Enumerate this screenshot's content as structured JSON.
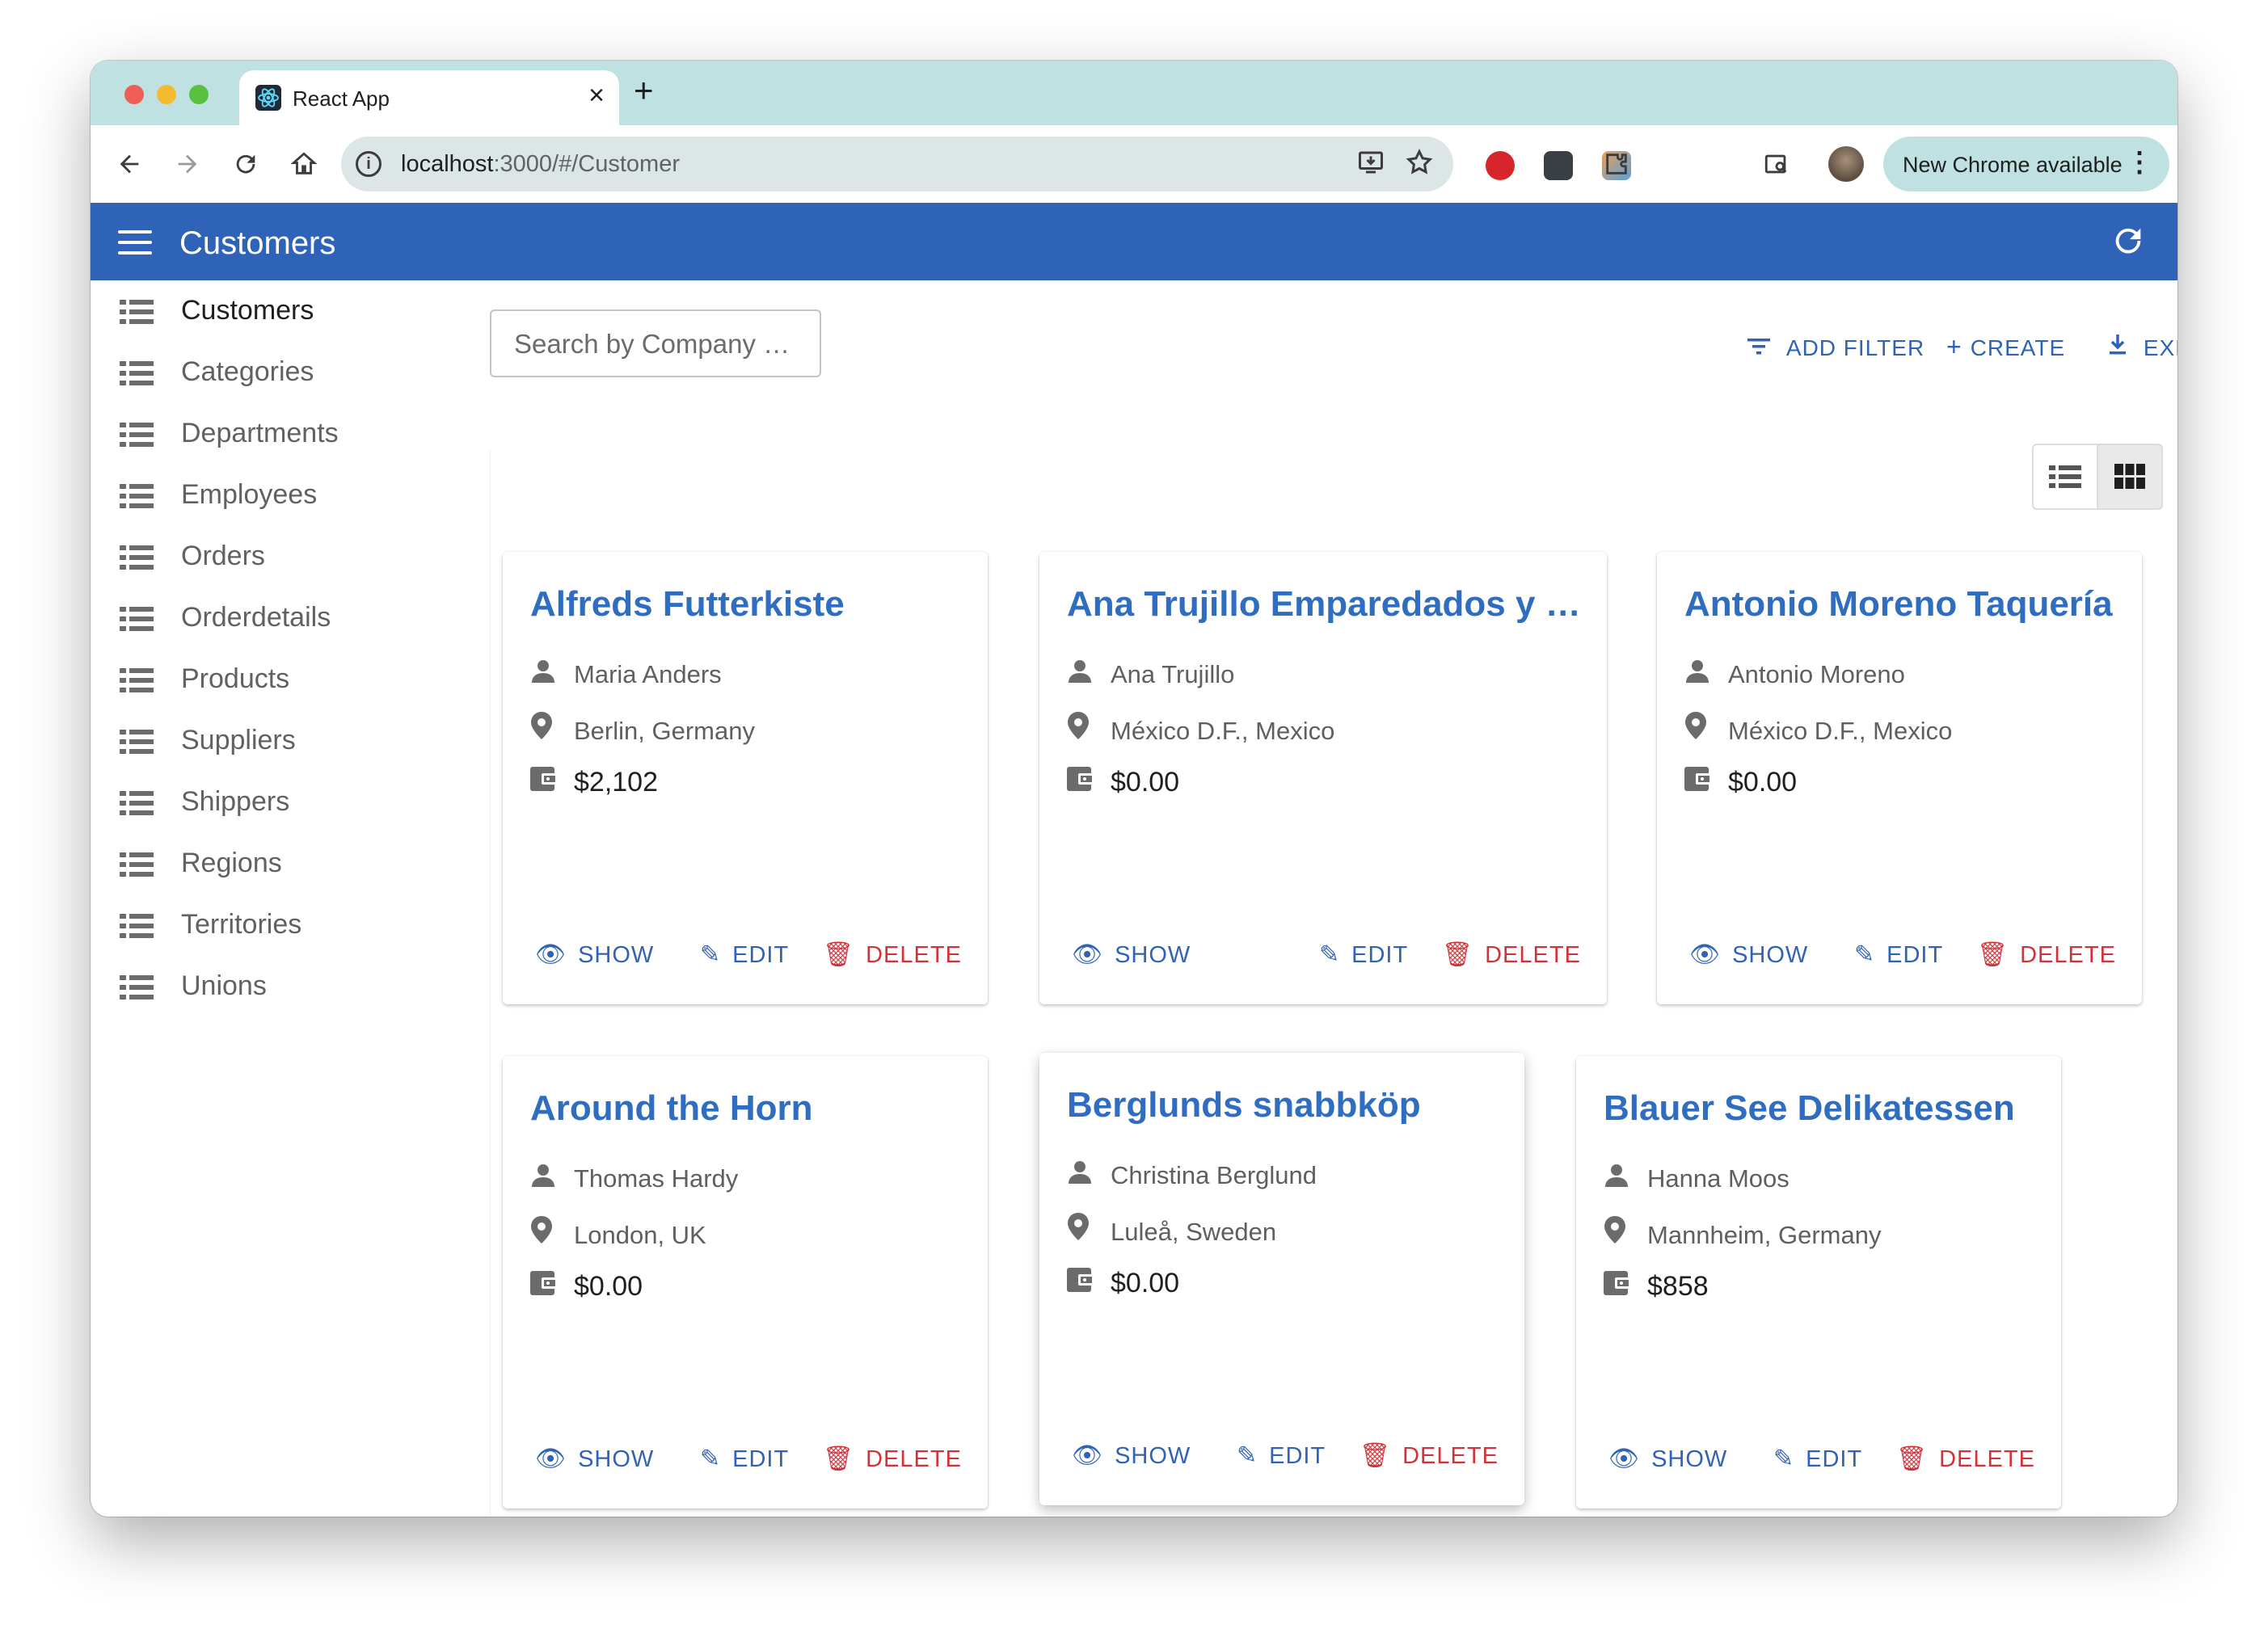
{
  "browser": {
    "tab_title": "React App",
    "tab_close": "×",
    "new_tab": "+",
    "url_host": "localhost",
    "url_path": ":3000/#/Customer",
    "update_label": "New Chrome available",
    "menu_glyph": "⋮"
  },
  "appbar": {
    "title": "Customers"
  },
  "sidebar": {
    "items": [
      {
        "label": "Customers"
      },
      {
        "label": "Categories"
      },
      {
        "label": "Departments"
      },
      {
        "label": "Employees"
      },
      {
        "label": "Orders"
      },
      {
        "label": "Orderdetails"
      },
      {
        "label": "Products"
      },
      {
        "label": "Suppliers"
      },
      {
        "label": "Shippers"
      },
      {
        "label": "Regions"
      },
      {
        "label": "Territories"
      },
      {
        "label": "Unions"
      }
    ]
  },
  "toolbar": {
    "search_placeholder": "Search by Company …",
    "add_filter": "ADD FILTER",
    "create": "CREATE",
    "export": "EXPORT"
  },
  "cards": [
    {
      "title": "Alfreds Futterkiste",
      "contact": "Maria Anders",
      "location": "Berlin, Germany",
      "balance": "$2,102"
    },
    {
      "title": "Ana Trujillo Emparedados y …",
      "contact": "Ana Trujillo",
      "location": "México D.F., Mexico",
      "balance": "$0.00"
    },
    {
      "title": "Antonio Moreno Taquería",
      "contact": "Antonio Moreno",
      "location": "México D.F., Mexico",
      "balance": "$0.00"
    },
    {
      "title": "Around the Horn",
      "contact": "Thomas Hardy",
      "location": "London, UK",
      "balance": "$0.00"
    },
    {
      "title": "Berglunds snabbköp",
      "contact": "Christina Berglund",
      "location": "Luleå, Sweden",
      "balance": "$0.00"
    },
    {
      "title": "Blauer See Delikatessen",
      "contact": "Hanna Moos",
      "location": "Mannheim, Germany",
      "balance": "$858"
    }
  ],
  "card_actions": {
    "show": "SHOW",
    "edit": "EDIT",
    "delete": "DELETE"
  },
  "colors": {
    "app_bar": "#2f63b8",
    "link_blue": "#2f6dc0",
    "delete_red": "#d0343a",
    "tab_strip": "#bfe1e2"
  }
}
